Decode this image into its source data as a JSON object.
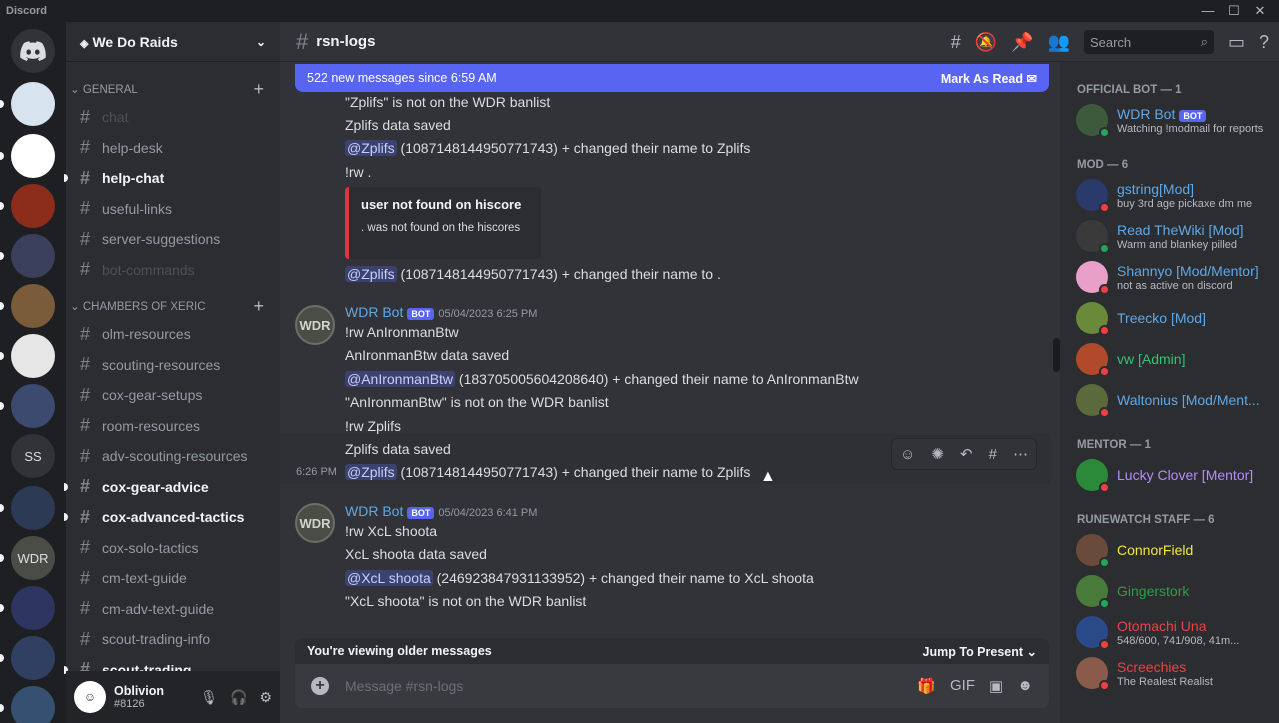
{
  "app_title": "Discord",
  "window_controls": [
    "—",
    "☐",
    "✕"
  ],
  "servers": [
    {
      "label": "",
      "color": "#5865f2"
    },
    {
      "label": "",
      "color": "#d8e3f0"
    },
    {
      "label": "",
      "color": "#ffffff"
    },
    {
      "label": "",
      "color": "#8b2d1a"
    },
    {
      "label": "",
      "color": "#3a3f5c"
    },
    {
      "label": "",
      "color": "#7a5b3a"
    },
    {
      "label": "",
      "color": "#e6e6e6"
    },
    {
      "label": "",
      "color": "#3b4a6e"
    },
    {
      "label": "SS",
      "color": "#313338"
    },
    {
      "label": "",
      "color": "#2c3a55"
    },
    {
      "label": "WDR",
      "color": "#4a4d45"
    },
    {
      "label": "",
      "color": "#2d3560"
    },
    {
      "label": "",
      "color": "#304062"
    },
    {
      "label": "",
      "color": "#355070"
    }
  ],
  "guild": {
    "name": "We Do Raids"
  },
  "categories": [
    {
      "name": "GENERAL",
      "channels": [
        {
          "name": "chat",
          "state": "muted"
        },
        {
          "name": "help-desk",
          "state": "normal"
        },
        {
          "name": "help-chat",
          "state": "unread"
        },
        {
          "name": "useful-links",
          "state": "normal"
        },
        {
          "name": "server-suggestions",
          "state": "normal"
        },
        {
          "name": "bot-commands",
          "state": "muted"
        }
      ]
    },
    {
      "name": "CHAMBERS OF XERIC",
      "channels": [
        {
          "name": "olm-resources",
          "state": "normal"
        },
        {
          "name": "scouting-resources",
          "state": "normal"
        },
        {
          "name": "cox-gear-setups",
          "state": "normal"
        },
        {
          "name": "room-resources",
          "state": "normal"
        },
        {
          "name": "adv-scouting-resources",
          "state": "normal"
        },
        {
          "name": "cox-gear-advice",
          "state": "unread"
        },
        {
          "name": "cox-advanced-tactics",
          "state": "unread"
        },
        {
          "name": "cox-solo-tactics",
          "state": "normal"
        },
        {
          "name": "cm-text-guide",
          "state": "normal"
        },
        {
          "name": "cm-adv-text-guide",
          "state": "normal"
        },
        {
          "name": "scout-trading-info",
          "state": "normal"
        },
        {
          "name": "scout-trading",
          "state": "unread"
        }
      ]
    }
  ],
  "user": {
    "name": "Oblivion",
    "tag": "#8126"
  },
  "header": {
    "channel": "rsn-logs",
    "search_placeholder": "Search"
  },
  "new_messages": {
    "text": "522 new messages since 6:59 AM",
    "action": "Mark As Read"
  },
  "messages_top": [
    {
      "text": "\"Zplifs\" is not on the WDR banlist"
    },
    {
      "text": "Zplifs data saved"
    },
    {
      "mention": "@Zplifs",
      "text": " (1087148144950771743) + changed their name to Zplifs"
    },
    {
      "text": "!rw ."
    }
  ],
  "embed": {
    "title": "user not found on hiscore",
    "desc": ". was not found on the hiscores"
  },
  "after_embed": {
    "mention": "@Zplifs",
    "text": " (1087148144950771743) + changed their name to ."
  },
  "group1": {
    "author": "WDR Bot",
    "badge": "BOT",
    "time": "05/04/2023 6:25 PM",
    "lines": [
      {
        "text": "!rw AnIronmanBtw"
      },
      {
        "text": "AnIronmanBtw data saved"
      },
      {
        "mention": "@AnIronmanBtw",
        "text": " (183705005604208640) + changed their name to AnIronmanBtw"
      },
      {
        "text": "\"AnIronmanBtw\" is not on the WDR banlist"
      },
      {
        "text": "!rw Zplifs"
      },
      {
        "text": "Zplifs data saved"
      },
      {
        "mention": "@Zplifs",
        "text": " (1087148144950771743) + changed their name to Zplifs"
      }
    ],
    "hover_time": "6:26 PM"
  },
  "group2": {
    "author": "WDR Bot",
    "badge": "BOT",
    "time": "05/04/2023 6:41 PM",
    "lines": [
      {
        "text": "!rw XcL shoota"
      },
      {
        "text": "XcL shoota data saved"
      },
      {
        "mention": "@XcL shoota",
        "text": " (246923847931133952) + changed their name to XcL shoota"
      },
      {
        "text": "\"XcL shoota\" is not on the WDR banlist"
      }
    ]
  },
  "older_bar": {
    "text": "You're viewing older messages",
    "action": "Jump To Present"
  },
  "composer": {
    "placeholder": "Message #rsn-logs"
  },
  "member_groups": [
    {
      "title": "OFFICIAL BOT — 1",
      "members": [
        {
          "name": "WDR Bot",
          "badge": "BOT",
          "status": "Watching !modmail for reports",
          "color": "#5fa8e8",
          "presence": "#23a55a"
        }
      ]
    },
    {
      "title": "MOD — 6",
      "members": [
        {
          "name": "gstring[Mod]",
          "status": "buy 3rd age pickaxe dm me",
          "color": "#5fa8e8",
          "presence": "#f23f43"
        },
        {
          "name": "Read TheWiki [Mod]",
          "status": "Warm and blankey pilled",
          "color": "#5fa8e8",
          "presence": "#23a55a"
        },
        {
          "name": "Shannyo [Mod/Mentor]",
          "status": "not as active on discord",
          "color": "#5fa8e8",
          "presence": "#f23f43"
        },
        {
          "name": "Treecko [Mod]",
          "status": "",
          "color": "#5fa8e8",
          "presence": "#f23f43"
        },
        {
          "name": "vw [Admin]",
          "status": "",
          "color": "#2dc770",
          "presence": "#f23f43"
        },
        {
          "name": "Waltonius [Mod/Ment...",
          "status": "",
          "color": "#5fa8e8",
          "presence": "#f23f43"
        }
      ]
    },
    {
      "title": "MENTOR — 1",
      "members": [
        {
          "name": "Lucky Clover [Mentor]",
          "status": "",
          "color": "#b68cf5",
          "presence": "#f23f43"
        }
      ]
    },
    {
      "title": "RUNEWATCH STAFF — 6",
      "members": [
        {
          "name": "ConnorField",
          "status": "",
          "color": "#f5e642",
          "presence": "#23a55a"
        },
        {
          "name": "Gingerstork",
          "status": "",
          "color": "#2f9e44",
          "presence": "#23a55a"
        },
        {
          "name": "Otomachi Una",
          "status": "548/600, 741/908, 41m...",
          "color": "#ed4245",
          "presence": "#f23f43"
        },
        {
          "name": "Screechies",
          "status": "The Realest Realist",
          "color": "#ed4245",
          "presence": "#f23f43"
        }
      ]
    }
  ]
}
